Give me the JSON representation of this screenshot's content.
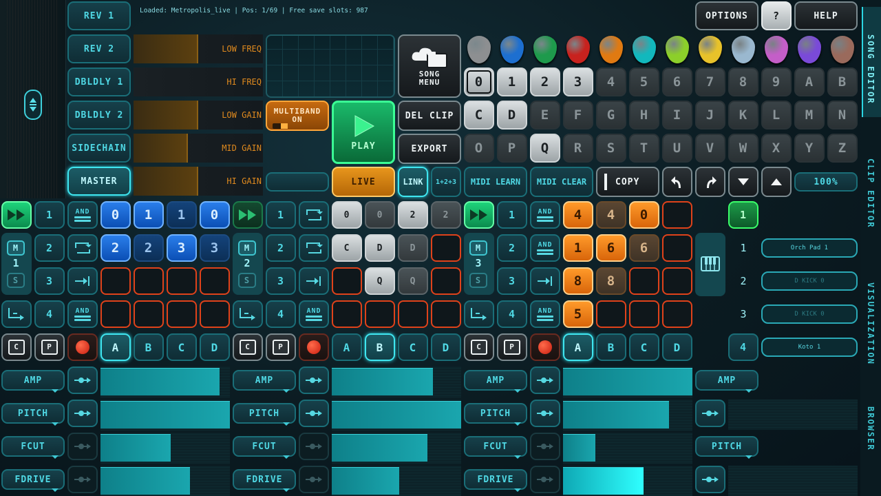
{
  "status": "Loaded: Metropolis_live | Pos: 1/69 | Free save slots: 987",
  "top_right": {
    "options": "OPTIONS",
    "question": "?",
    "help": "HELP"
  },
  "fx_buttons": [
    "REV 1",
    "REV 2",
    "DBLDLY 1",
    "DBLDLY 2",
    "SIDECHAIN",
    "MASTER"
  ],
  "eq_labels": [
    "LOW FREQ",
    "HI FREQ",
    "LOW GAIN",
    "MID GAIN",
    "HI GAIN"
  ],
  "eq_levels": [
    0.5,
    0.0,
    0.5,
    0.42,
    0.5
  ],
  "multiband": "MULTIBAND\nON",
  "song_menu": "SONG\nMENU",
  "play": "PLAY",
  "del_clip": "DEL CLIP",
  "export": "EXPORT",
  "live": "LIVE",
  "link": "LINK",
  "combo": "1+2+3",
  "midi_learn": "MIDI LEARN",
  "midi_clear": "MIDI CLEAR",
  "copy": "COPY",
  "zoom": "100%",
  "pick_colors": [
    "#8d8f91",
    "#1d6fd0",
    "#1e9a4c",
    "#c8221e",
    "#e07a12",
    "#12b8bd",
    "#8ccf2a",
    "#e8c22a",
    "#9ab8cf",
    "#c45ec8",
    "#7a4ad8",
    "#9a6a5c"
  ],
  "grid_row1": [
    "0",
    "1",
    "2",
    "3",
    "4",
    "5",
    "6",
    "7",
    "8",
    "9",
    "A",
    "B"
  ],
  "grid_row2": [
    "C",
    "D",
    "E",
    "F",
    "G",
    "H",
    "I",
    "J",
    "K",
    "L",
    "M",
    "N"
  ],
  "grid_row3": [
    "O",
    "P",
    "Q",
    "R",
    "S",
    "T",
    "U",
    "V",
    "W",
    "X",
    "Y",
    "Z"
  ],
  "tracks": [
    {
      "num": "1",
      "seq": [
        "1",
        "2",
        "3",
        "4"
      ],
      "and": "AND",
      "pads": [
        [
          "0",
          "1",
          "1",
          "0"
        ],
        [
          "2",
          "2",
          "3",
          "3"
        ],
        [
          "",
          "",
          "",
          ""
        ],
        [
          "",
          "",
          "",
          ""
        ]
      ],
      "abcd": [
        "A",
        "B",
        "C",
        "D"
      ],
      "params": [
        "AMP",
        "PITCH",
        "FCUT",
        "FDRIVE"
      ],
      "param_levels": [
        0.92,
        1.0,
        0.54,
        0.69
      ]
    },
    {
      "num": "2",
      "seq": [
        "1",
        "2",
        "3",
        "4"
      ],
      "and": "AND",
      "pads": [
        [
          "0",
          "0",
          "2",
          "2"
        ],
        [
          "C",
          "D",
          "D",
          ""
        ],
        [
          "",
          "Q",
          "Q",
          ""
        ],
        [
          "",
          "",
          "",
          ""
        ]
      ],
      "abcd": [
        "A",
        "B",
        "C",
        "D"
      ],
      "params": [
        "AMP",
        "PITCH",
        "FCUT",
        "FDRIVE"
      ],
      "param_levels": [
        0.78,
        1.0,
        0.74,
        0.52
      ]
    },
    {
      "num": "3",
      "seq": [
        "1",
        "2",
        "3",
        "4"
      ],
      "and": "AND",
      "pads": [
        [
          "4",
          "4",
          "0",
          ""
        ],
        [
          "1",
          "6",
          "6",
          ""
        ],
        [
          "8",
          "8",
          "",
          ""
        ],
        [
          "5",
          "",
          "",
          ""
        ]
      ],
      "abcd": [
        "A",
        "B",
        "C",
        "D"
      ],
      "params": [
        "AMP",
        "PITCH",
        "FCUT",
        "FDRIVE"
      ],
      "param_levels": [
        1.0,
        0.82,
        0.25,
        0.62
      ]
    }
  ],
  "track4": {
    "rows": [
      "1",
      "1",
      "2",
      "3",
      "4"
    ],
    "slots": [
      "Orch Pad 1",
      "D KICK 0",
      "D KICK 0",
      "Koto 1"
    ],
    "params": [
      "AMP",
      "PITCH"
    ]
  },
  "side_tabs": [
    "SONG EDITOR",
    "CLIP EDITOR",
    "VISUALIZATION",
    "BROWSER"
  ],
  "track_mute": "M",
  "track_solo": "S",
  "clip_c": "C",
  "clip_p": "P"
}
